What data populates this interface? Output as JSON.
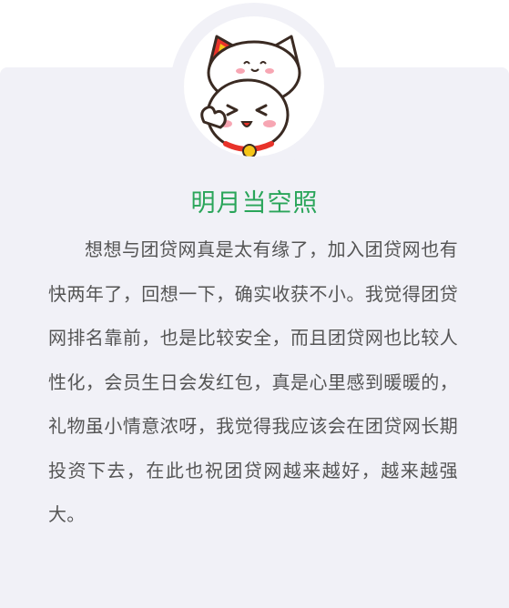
{
  "avatar": {
    "icon": "lucky-cat-icon",
    "colors": {
      "ear": "#e8332a",
      "ear_inner": "#f5c518",
      "outline": "#3a2a22",
      "cheek": "#f7a6b3",
      "collar": "#e8332a",
      "bell": "#f5c518"
    }
  },
  "testimonial": {
    "name": "明月当空照",
    "text": "想想与团贷网真是太有缘了，加入团贷网也有快两年了，回想一下，确实收获不小。我觉得团贷网排名靠前，也是比较安全，而且团贷网也比较人性化，会员生日会发红包，真是心里感到暖暖的，礼物虽小情意浓呀，我觉得我应该会在团贷网长期投资下去，在此也祝团贷网越来越好，越来越强大。"
  },
  "colors": {
    "card_background": "#f1f1f7",
    "name": "#2aa55a",
    "body_text": "#555555"
  }
}
